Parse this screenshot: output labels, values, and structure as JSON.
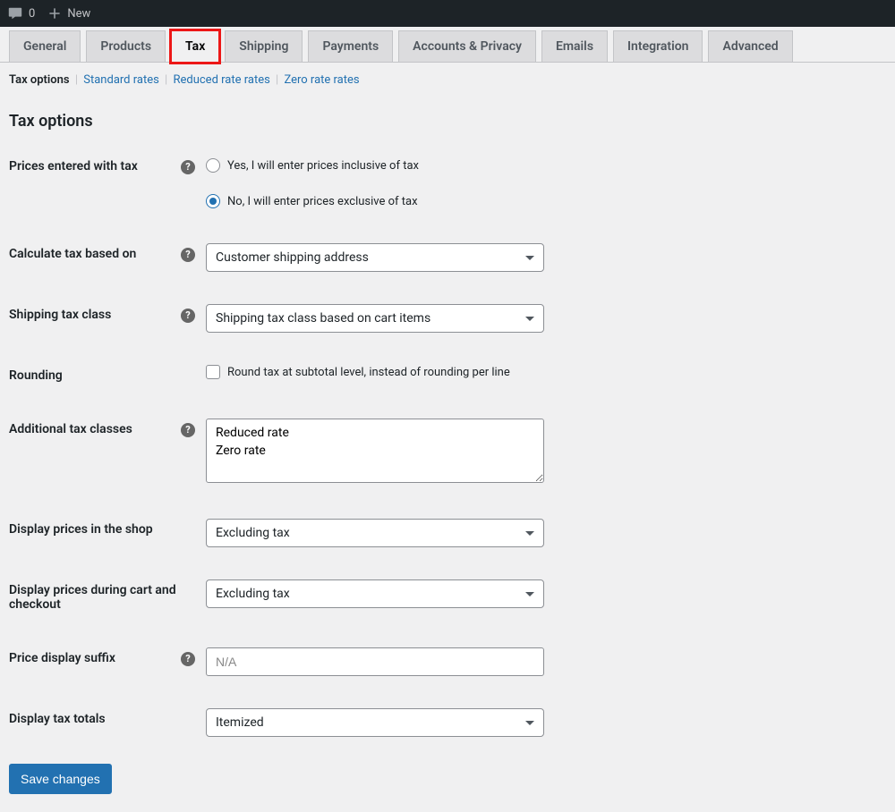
{
  "adminbar": {
    "comments_count": "0",
    "new_label": "New"
  },
  "tabs": [
    "General",
    "Products",
    "Tax",
    "Shipping",
    "Payments",
    "Accounts & Privacy",
    "Emails",
    "Integration",
    "Advanced"
  ],
  "active_tab": "Tax",
  "subnav": {
    "current": "Tax options",
    "links": [
      "Standard rates",
      "Reduced rate rates",
      "Zero rate rates"
    ]
  },
  "section_title": "Tax options",
  "fields": {
    "prices_entered": {
      "label": "Prices entered with tax",
      "opt_yes": "Yes, I will enter prices inclusive of tax",
      "opt_no": "No, I will enter prices exclusive of tax",
      "selected": "no"
    },
    "calculate": {
      "label": "Calculate tax based on",
      "value": "Customer shipping address"
    },
    "shipping_class": {
      "label": "Shipping tax class",
      "value": "Shipping tax class based on cart items"
    },
    "rounding": {
      "label": "Rounding",
      "checkbox_label": "Round tax at subtotal level, instead of rounding per line"
    },
    "additional": {
      "label": "Additional tax classes",
      "value": "Reduced rate\nZero rate"
    },
    "display_shop": {
      "label": "Display prices in the shop",
      "value": "Excluding tax"
    },
    "display_cart": {
      "label": "Display prices during cart and checkout",
      "value": "Excluding tax"
    },
    "suffix": {
      "label": "Price display suffix",
      "placeholder": "N/A",
      "value": ""
    },
    "totals": {
      "label": "Display tax totals",
      "value": "Itemized"
    }
  },
  "submit_label": "Save changes"
}
